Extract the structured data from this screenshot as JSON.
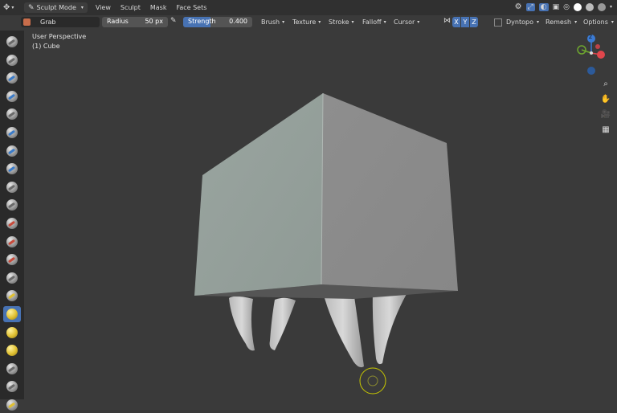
{
  "header": {
    "mode_label": "Sculpt Mode",
    "menus": [
      "View",
      "Sculpt",
      "Mask",
      "Face Sets"
    ]
  },
  "tool_header": {
    "brush_name": "Grab",
    "radius": {
      "label": "Radius",
      "value": "50 px"
    },
    "strength": {
      "label": "Strength",
      "value": "0.400",
      "fraction": 0.4
    },
    "dropdowns": [
      "Brush",
      "Texture",
      "Stroke",
      "Falloff",
      "Cursor"
    ],
    "axes": [
      "X",
      "Y",
      "Z"
    ],
    "dyntopo_label": "Dyntopo",
    "remesh_label": "Remesh",
    "options_label": "Options"
  },
  "viewport": {
    "perspective_label": "User Perspective",
    "object_label": "(1) Cube"
  },
  "gizmo": {
    "axes": {
      "z": "Z"
    },
    "colors": {
      "x": "#e0464c",
      "y": "#6ea62f",
      "z": "#3b7bd4"
    }
  },
  "toolbar": {
    "tools": [
      "draw",
      "draw-sharp",
      "clay",
      "clay-strips",
      "clay-thumb",
      "layer",
      "inflate",
      "blob",
      "crease",
      "smooth",
      "flatten",
      "fill",
      "scrape",
      "multiplane-scrape",
      "pinch",
      "grab",
      "elastic-deform",
      "snake-hook",
      "thumb",
      "pose",
      "nudge"
    ],
    "active_index": 15
  },
  "colors": {
    "accent": "#4772b3",
    "cube_light": "#9aa39d",
    "cube_right": "#8f8f8f",
    "cursor_ring": "#c8c800"
  }
}
